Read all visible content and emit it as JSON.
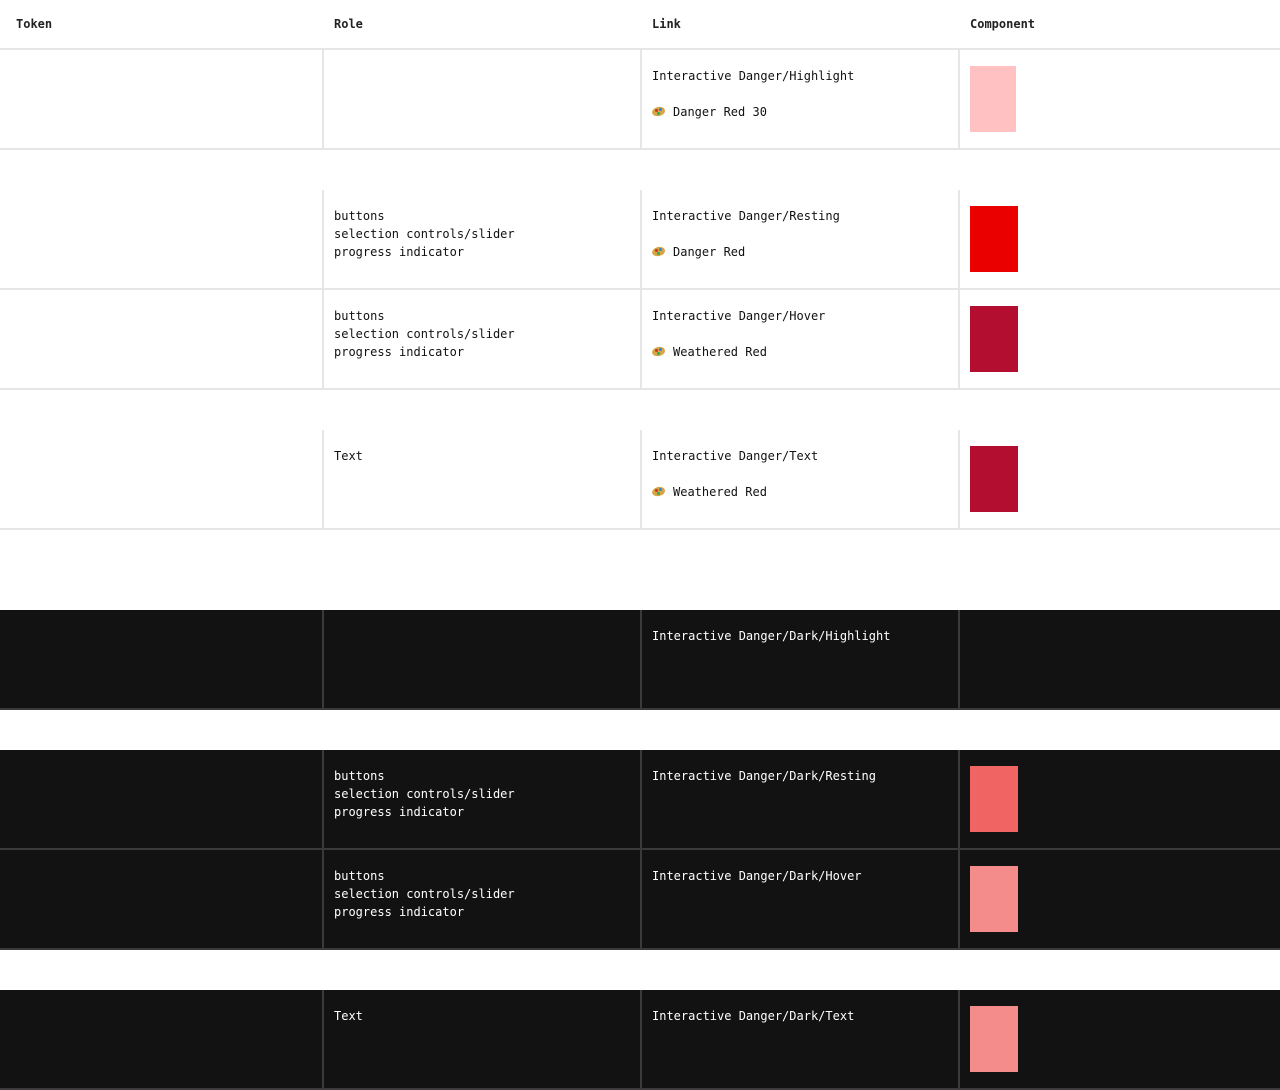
{
  "header": {
    "token": "Token",
    "role": "Role",
    "link": "Link",
    "component": "Component"
  },
  "rows": [
    {
      "theme": "light",
      "role": "",
      "link_name": "Interactive Danger/Highlight",
      "link_ref": "Danger Red 30",
      "swatch": "#ffc1c1"
    },
    {
      "theme": "light",
      "role": "buttons\nselection controls/slider\nprogress indicator",
      "link_name": "Interactive Danger/Resting",
      "link_ref": "Danger Red",
      "swatch": "#eb0000"
    },
    {
      "theme": "light",
      "role": "buttons\nselection controls/slider\nprogress indicator",
      "link_name": "Interactive Danger/Hover",
      "link_ref": "Weathered Red",
      "swatch": "#b30d2f"
    },
    {
      "theme": "light",
      "role": "Text",
      "link_name": "Interactive Danger/Text",
      "link_ref": "Weathered Red",
      "swatch": "#b30d2f"
    },
    {
      "theme": "dark",
      "role": "",
      "link_name": "Interactive Danger/Dark/Highlight",
      "link_ref": "",
      "swatch": ""
    },
    {
      "theme": "dark",
      "role": "buttons\nselection controls/slider\nprogress indicator",
      "link_name": "Interactive Danger/Dark/Resting",
      "link_ref": "",
      "swatch": "#f06464"
    },
    {
      "theme": "dark",
      "role": "buttons\nselection controls/slider\nprogress indicator",
      "link_name": "Interactive Danger/Dark/Hover",
      "link_ref": "",
      "swatch": "#f48c8c"
    },
    {
      "theme": "dark",
      "role": "Text",
      "link_name": "Interactive Danger/Dark/Text",
      "link_ref": "",
      "swatch": "#f48c8c"
    }
  ]
}
